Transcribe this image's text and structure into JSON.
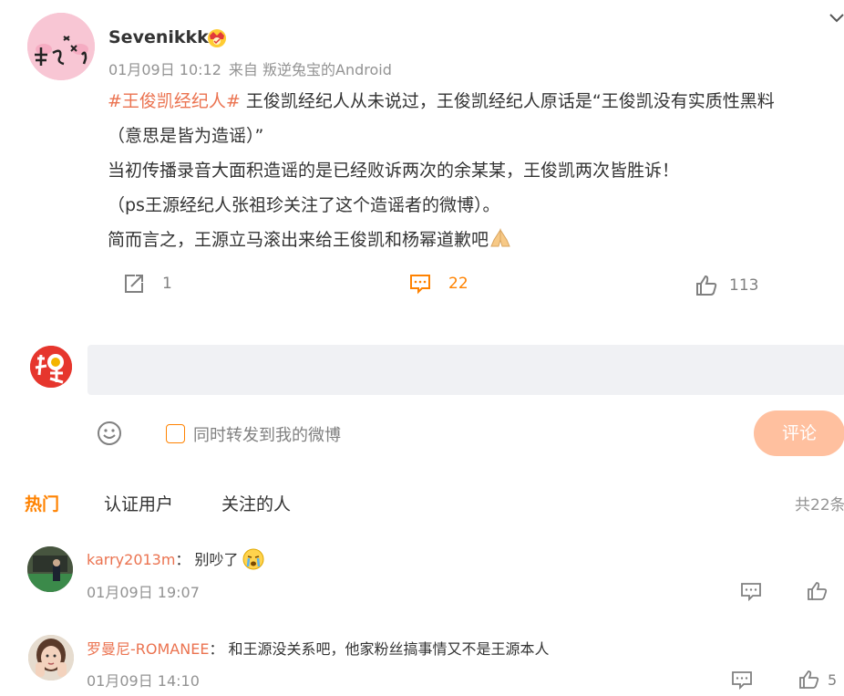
{
  "post": {
    "username": "Sevenikkk",
    "time": "01月09日 10:12",
    "source": "来自 叛逆兔宝的Android",
    "hashtag": "#王俊凯经纪人#",
    "line1_rest": " 王俊凯经纪人从未说过，王俊凯经纪人原话是“王俊凯没有实质性黑料",
    "line2": "（意思是皆为造谣）”",
    "line3": "当初传播录音大面积造谣的是已经败诉两次的余某某，王俊凯两次皆胜诉！",
    "line4": "（ps王源经纪人张祖珍关注了这个造谣者的微博）。",
    "line5": "简而言之，王源立马滚出来给王俊凯和杨幂道歉吧",
    "repost_count": "1",
    "comment_count": "22",
    "like_count": "113"
  },
  "compose": {
    "placeholder": "",
    "repost_checkbox_label": "同时转发到我的微博",
    "submit_label": "评论"
  },
  "tabs": {
    "hot": "热门",
    "verified": "认证用户",
    "following": "关注的人"
  },
  "total_count": "共22条",
  "comments": [
    {
      "user": "karry2013m",
      "sep": "：",
      "text": " 别吵了",
      "time": "01月09日 19:07",
      "likes": ""
    },
    {
      "user": "罗曼尼-ROMANEE",
      "sep": "：",
      "text": " 和王源没关系吧，他家粉丝搞事情又不是王源本人",
      "time": "01月09日 14:10",
      "likes": "5"
    }
  ],
  "colors": {
    "accent": "#ff8200",
    "link": "#eb7350",
    "muted": "#939393",
    "button_disabled": "#ffc09f"
  },
  "icons": {
    "repost": "repost-icon",
    "comment": "comment-icon",
    "like": "thumbs-up-icon",
    "emoji": "smile-icon",
    "expand": "chevron-down-icon"
  }
}
